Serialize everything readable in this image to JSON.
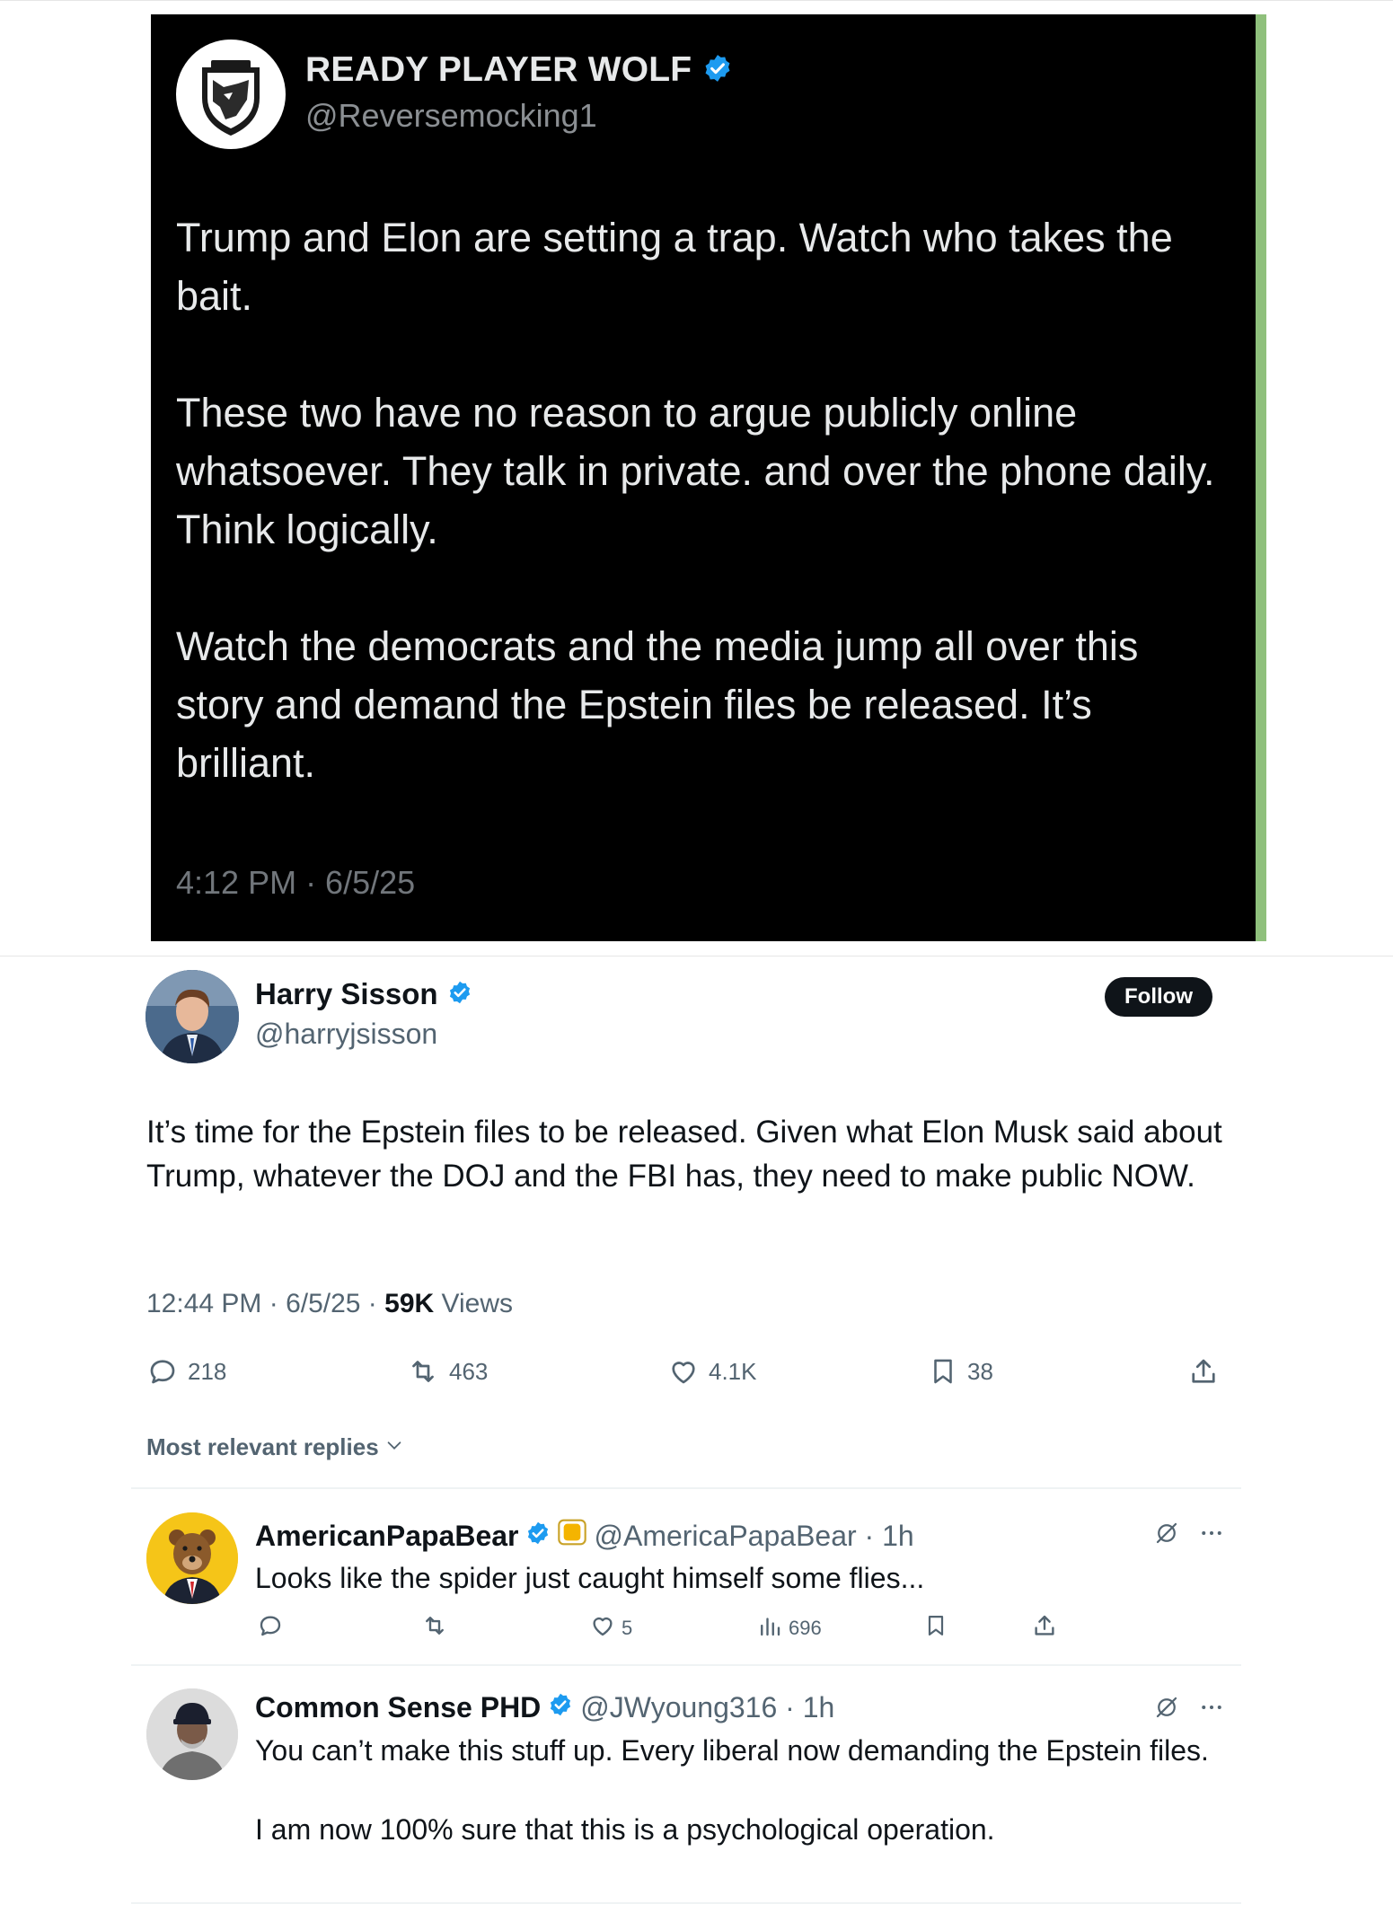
{
  "dark_tweet": {
    "name": "READY PLAYER WOLF",
    "handle": "@Reversemocking1",
    "paragraphs": [
      "Trump and Elon are setting a trap. Watch who takes the bait.",
      "These two have no reason to argue publicly online whatsoever. They talk in private. and over the phone daily. Think logically.",
      "Watch the democrats and the media jump all over this story and demand the Epstein files be released. It’s brilliant."
    ],
    "timestamp": "4:12 PM · 6/5/25"
  },
  "main_tweet": {
    "name": "Harry Sisson",
    "handle": "@harryjsisson",
    "follow_label": "Follow",
    "text": "It’s time for the Epstein files to be released. Given what Elon Musk said about Trump, whatever the DOJ and the FBI has, they need to make public NOW.",
    "time": "12:44 PM · 6/5/25 · ",
    "views_count": "59K",
    "views_label": " Views",
    "replies": "218",
    "reposts": "463",
    "likes": "4.1K",
    "bookmarks": "38",
    "sort_label": "Most relevant replies"
  },
  "replies": [
    {
      "name": "AmericanPapaBear",
      "handle": "@AmericaPapaBear · 1h",
      "text": "Looks like the spider just caught himself some flies...",
      "likes": "5",
      "views": "696"
    },
    {
      "name": "Common Sense PHD",
      "handle": "@JWyoung316 · 1h",
      "paragraphs": [
        "You can’t make this stuff up. Every liberal now demanding the Epstein files.",
        "I am now 100% sure that this is a psychological operation."
      ]
    }
  ],
  "colors": {
    "verified": "#1d9bf0",
    "dark_bg": "#000000",
    "follow_bg": "#0f1419",
    "side_accent": "#8fc07c"
  },
  "icons": [
    "verified-badge-icon",
    "wolf-shield-logo",
    "reply-icon",
    "repost-icon",
    "like-icon",
    "bookmark-icon",
    "share-icon",
    "views-icon",
    "grok-icon",
    "more-icon",
    "chevron-down-icon"
  ]
}
